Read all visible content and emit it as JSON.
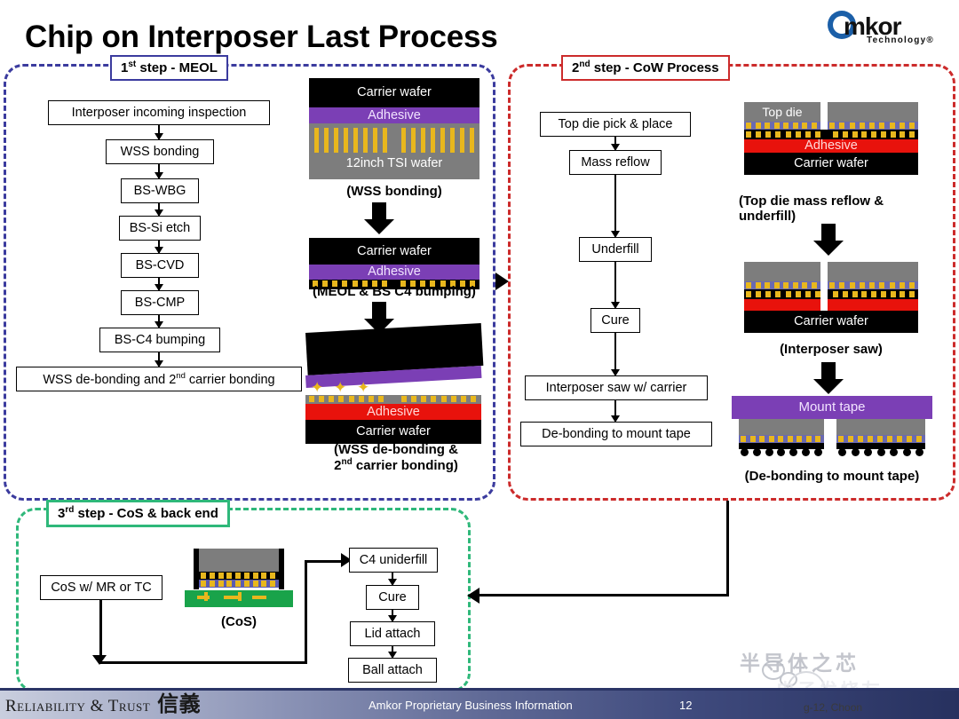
{
  "slide": {
    "title": "Chip on Interposer Last Process",
    "page_number": "12"
  },
  "logo": {
    "word": "mkor",
    "sub": "Technology®",
    "mark": "amkor-circle-a"
  },
  "panels": {
    "meol": {
      "tag": "1st step - MEOL",
      "tag_sup_base": "1",
      "tag_sup": "st",
      "tag_rest": " step - MEOL",
      "color": "#3b3b9e"
    },
    "cow": {
      "tag": "2nd step - CoW Process",
      "tag_sup_base": "2",
      "tag_sup": "nd",
      "tag_rest": " step - CoW Process",
      "color": "#cc2b2b"
    },
    "cos": {
      "tag": "3rd step - CoS & back end",
      "tag_sup_base": "3",
      "tag_sup": "rd",
      "tag_rest": " step - CoS & back end",
      "color": "#2fb87a"
    }
  },
  "meol_flow": [
    "Interposer incoming inspection",
    "WSS bonding",
    "BS-WBG",
    "BS-Si etch",
    "BS-CVD",
    "BS-CMP",
    "BS-C4 bumping"
  ],
  "meol_flow_last": {
    "pre": "WSS de-bonding and 2",
    "sup": "nd",
    "post": " carrier bonding"
  },
  "cow_flow": [
    "Top die pick & place",
    "Mass reflow",
    "Underfill",
    "Cure",
    "Interposer saw w/ carrier",
    "De-bonding to mount tape"
  ],
  "cos_flow": {
    "left_box": "CoS w/ MR or TC",
    "right_boxes": [
      "C4 uniderfill",
      "Cure",
      "Lid attach",
      "Ball attach"
    ],
    "illustration_caption": "(CoS)"
  },
  "illustrations": {
    "wss_bonding": {
      "caption": "(WSS bonding)",
      "layers": [
        "Carrier wafer",
        "Adhesive",
        "12inch TSI wafer"
      ]
    },
    "meol_bs_c4": {
      "caption": "(MEOL & BS C4 bumping)",
      "layers": [
        "Carrier wafer",
        "Adhesive"
      ]
    },
    "wss_debonding": {
      "caption_line1": "(WSS de-bonding &",
      "caption_line2_pre": "2",
      "caption_line2_sup": "nd",
      "caption_line2_post": " carrier bonding)",
      "layers": [
        "Adhesive",
        "Carrier wafer"
      ]
    },
    "top_die_reflow": {
      "caption_line1": "(Top die mass reflow &",
      "caption_line2": "underfill)",
      "layers": [
        "Top die",
        "Adhesive",
        "Carrier wafer"
      ]
    },
    "interposer_saw": {
      "caption": "(Interposer saw)",
      "layers": [
        "Carrier wafer"
      ]
    },
    "mount_tape": {
      "caption": "(De-bonding to mount tape)",
      "layers": [
        "Mount tape"
      ]
    }
  },
  "footer": {
    "left_mark_text": "Reliability & Trust",
    "left_mark_cjk": "信義",
    "center": "Amkor Proprietary Business Information",
    "page": "12",
    "note": "g-12, Choon"
  },
  "watermarks": {
    "wechat_text": "半导体之芯",
    "site_text": "电子发烧友"
  },
  "colors": {
    "meol_border": "#3b3b9e",
    "cow_border": "#cc2b2b",
    "cos_border": "#2fb87a",
    "adhesive_purple": "#7b3fb5",
    "adhesive_red": "#e8120c",
    "wafer_black": "#000000",
    "silicon_grey": "#7d7d7d",
    "bump_gold": "#e8b71d",
    "substrate_green": "#19a34a"
  }
}
